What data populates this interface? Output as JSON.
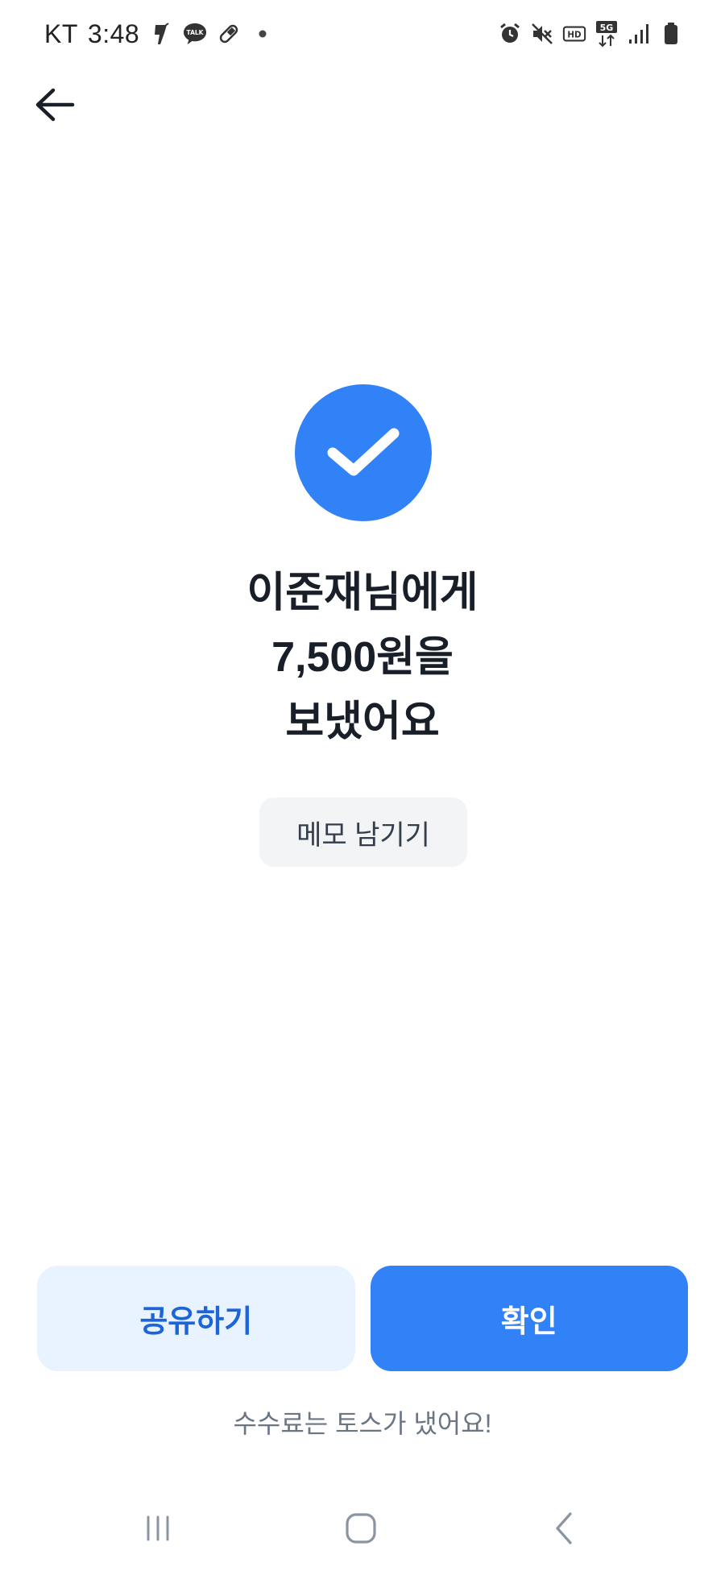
{
  "status_bar": {
    "carrier": "KT",
    "time": "3:48",
    "left_icons": [
      "torch-notification-icon",
      "kakaotalk-icon",
      "pill-icon",
      "dot-icon"
    ],
    "kakaotalk_badge": "TALK",
    "network_hd": "HD",
    "network_type": "5G",
    "right_icons": [
      "alarm-icon",
      "mute-icon",
      "hd-icon",
      "5g-icon",
      "signal-icon",
      "battery-icon"
    ]
  },
  "header": {
    "back_icon": "arrow-left-icon"
  },
  "result": {
    "icon": "check-icon",
    "line1": "이준재님에게",
    "line2": "7,500원을",
    "line3": "보냈어요",
    "memo_label": "메모 남기기"
  },
  "actions": {
    "share_label": "공유하기",
    "confirm_label": "확인"
  },
  "footer": {
    "fee_note": "수수료는 토스가 냈어요!"
  },
  "nav_bar": {
    "icons": [
      "recents-icon",
      "home-icon",
      "back-icon"
    ]
  },
  "colors": {
    "accent": "#3182f6",
    "accent_light": "#e8f3ff",
    "share_text": "#1b64da",
    "memo_bg": "#f2f4f6",
    "text_primary": "#191f28",
    "text_secondary": "#6b7684"
  }
}
